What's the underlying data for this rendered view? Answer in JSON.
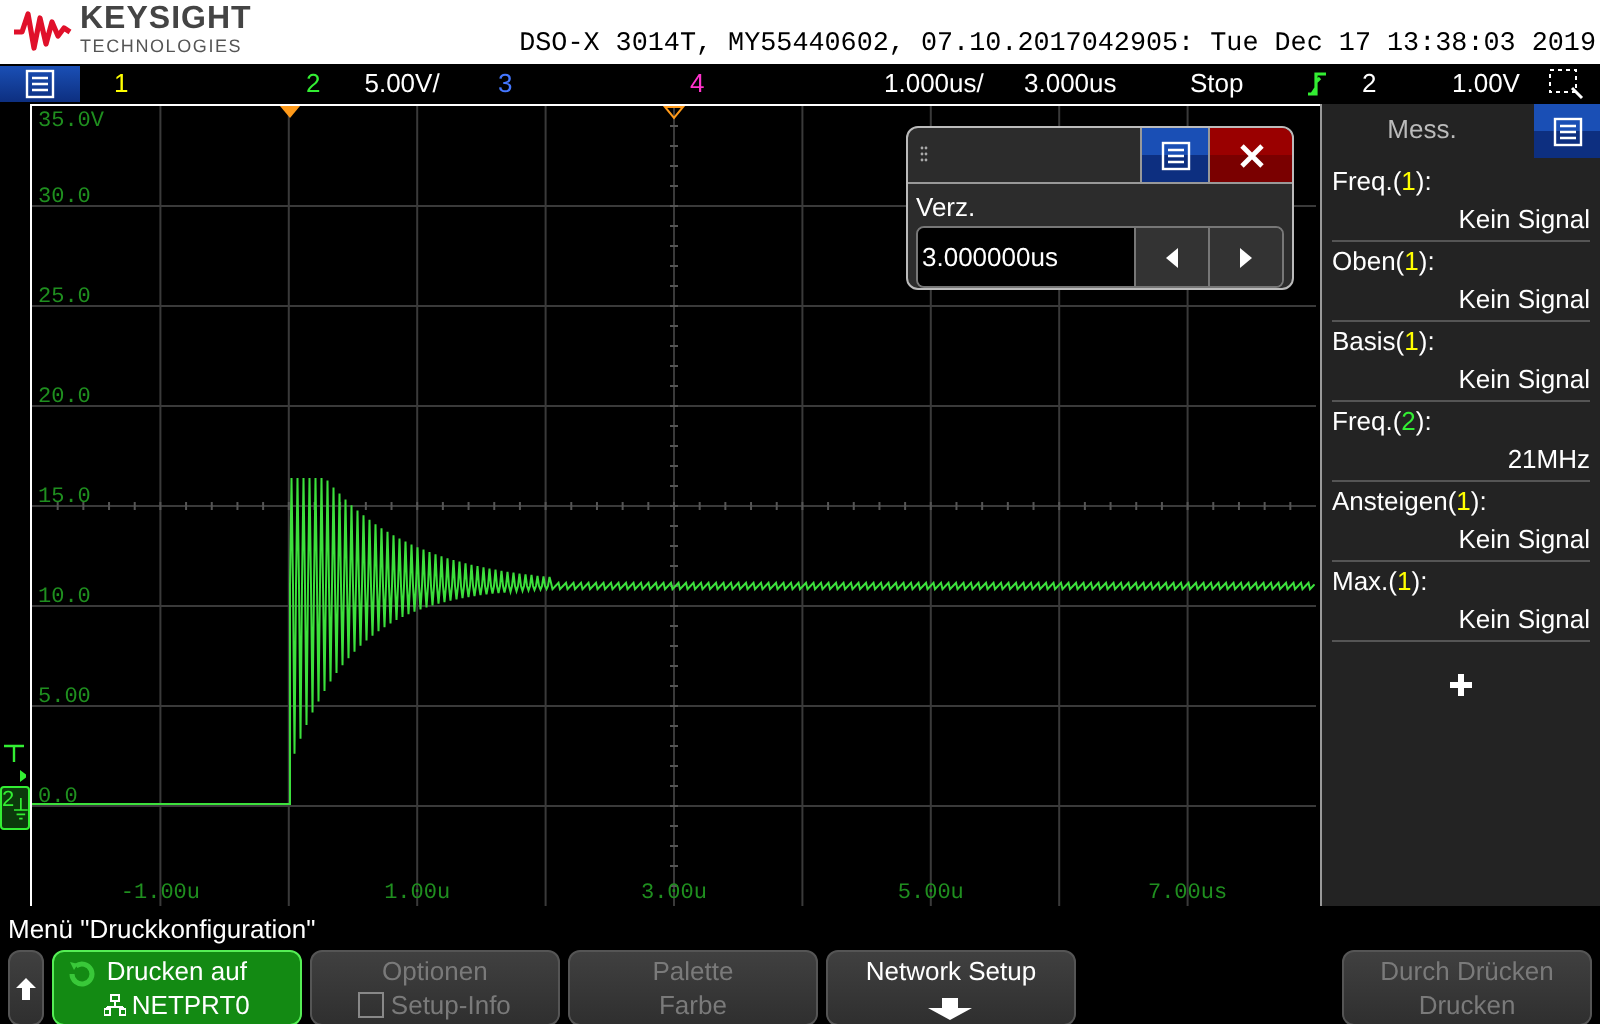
{
  "header": {
    "brand": "KEYSIGHT",
    "brand_sub": "TECHNOLOGIES",
    "title": "DSO-X 3014T, MY55440602, 07.10.2017042905: Tue Dec 17 13:38:03 2019"
  },
  "top_bar": {
    "channels": [
      {
        "label": "1",
        "color": "#ffff00"
      },
      {
        "label": "2",
        "color": "#33ee33",
        "scale": "5.00V/"
      },
      {
        "label": "3",
        "color": "#4477ff"
      },
      {
        "label": "4",
        "color": "#ff33cc"
      }
    ],
    "timebase": "1.000us/",
    "delay": "3.000us",
    "run_state": "Stop",
    "trigger_source": "2",
    "trigger_level": "1.00V"
  },
  "plot": {
    "y_labels": [
      "35.0V",
      "30.0",
      "25.0",
      "20.0",
      "15.0",
      "10.0",
      "5.00",
      "0.0"
    ],
    "x_labels": [
      "-1.00u",
      "1.00u",
      "3.00u",
      "5.00u",
      "7.00us"
    ],
    "channel_marker": "2"
  },
  "delay_dialog": {
    "label": "Verz.",
    "value": "3.000000us"
  },
  "measurements": {
    "title": "Mess.",
    "items": [
      {
        "label": "Freq.(",
        "channel": "1",
        "end": "):",
        "color": "#ffff00",
        "value": "Kein Signal"
      },
      {
        "label": "Oben(",
        "channel": "1",
        "end": "):",
        "color": "#ffff00",
        "value": "Kein Signal"
      },
      {
        "label": "Basis(",
        "channel": "1",
        "end": "):",
        "color": "#ffff00",
        "value": "Kein Signal"
      },
      {
        "label": "Freq.(",
        "channel": "2",
        "end": "):",
        "color": "#33ee33",
        "value": "21MHz"
      },
      {
        "label": "Ansteigen(",
        "channel": "1",
        "end": "):",
        "color": "#ffff00",
        "value": "Kein Signal"
      },
      {
        "label": "Max.(",
        "channel": "1",
        "end": "):",
        "color": "#ffff00",
        "value": "Kein Signal"
      }
    ]
  },
  "menu": {
    "title": "Menü \"Druckkonfiguration\"",
    "softkeys": [
      {
        "kind": "up"
      },
      {
        "kind": "select",
        "line1": "Drucken auf",
        "line2": "NETPRT0",
        "disabled": false
      },
      {
        "kind": "checkbox",
        "line1": "Optionen",
        "line2": "Setup-Info",
        "checked": false,
        "disabled": true
      },
      {
        "kind": "plain",
        "line1": "Palette",
        "line2": "Farbe",
        "disabled": true
      },
      {
        "kind": "submenu",
        "line1": "Network Setup",
        "disabled": false
      },
      {
        "kind": "empty"
      },
      {
        "kind": "plain",
        "line1": "Durch Drücken",
        "line2": "Drucken",
        "disabled": true
      }
    ]
  }
}
